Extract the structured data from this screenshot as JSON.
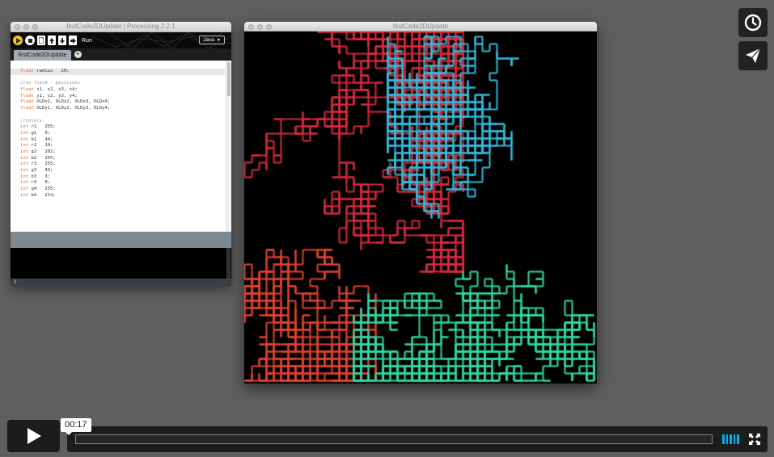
{
  "ide": {
    "window_title": "firstCode2DUpdate | Processing 2.2.1",
    "run_label": "Run",
    "mode": "Java",
    "tab_label": "firstCode2DUpdate",
    "line_number": "2",
    "code_lines": [
      [
        {
          "t": "float",
          "c": "kw"
        },
        {
          "t": " radius   20;"
        }
      ],
      [
        {
          "t": ""
        }
      ],
      [
        {
          "t": "//on field - positions",
          "c": "cm"
        }
      ],
      [
        {
          "t": "float",
          "c": "kw"
        },
        {
          "t": " x1, x2, x3, x4;"
        }
      ],
      [
        {
          "t": "float",
          "c": "kw"
        },
        {
          "t": " y1, y2, y3, y4;"
        }
      ],
      [
        {
          "t": "float",
          "c": "kw"
        },
        {
          "t": " OLDx1, OLDx2, OLDx3, OLDx4;"
        }
      ],
      [
        {
          "t": "float",
          "c": "kw"
        },
        {
          "t": " OLDy1, OLDy2, OLDy3, OLDy4;"
        }
      ],
      [
        {
          "t": ""
        }
      ],
      [
        {
          "t": "//colors",
          "c": "cm"
        }
      ],
      [
        {
          "t": "int",
          "c": "kw"
        },
        {
          "t": " r1   255;"
        }
      ],
      [
        {
          "t": "int",
          "c": "kw"
        },
        {
          "t": " g1   0;"
        }
      ],
      [
        {
          "t": "int",
          "c": "kw"
        },
        {
          "t": " b1   44;"
        }
      ],
      [
        {
          "t": "int",
          "c": "kw"
        },
        {
          "t": " r2   10;"
        }
      ],
      [
        {
          "t": "int",
          "c": "kw"
        },
        {
          "t": " g2   202;"
        }
      ],
      [
        {
          "t": "int",
          "c": "kw"
        },
        {
          "t": " b2   255;"
        }
      ],
      [
        {
          "t": "int",
          "c": "kw"
        },
        {
          "t": " r3   255;"
        }
      ],
      [
        {
          "t": "int",
          "c": "kw"
        },
        {
          "t": " g3   49;"
        }
      ],
      [
        {
          "t": "int",
          "c": "kw"
        },
        {
          "t": " b3   3;"
        }
      ],
      [
        {
          "t": "int",
          "c": "kw"
        },
        {
          "t": " r4   0;"
        }
      ],
      [
        {
          "t": "int",
          "c": "kw"
        },
        {
          "t": " g4   255;"
        }
      ],
      [
        {
          "t": "int",
          "c": "kw"
        },
        {
          "t": " b4   214;"
        }
      ]
    ]
  },
  "sketch": {
    "window_title": "firstCode2DUpdate",
    "walker_colors": [
      "#d8283d",
      "#36b8d8",
      "#e0412f",
      "#2fd9a4"
    ]
  },
  "player": {
    "time": "00:17",
    "played_fraction": 0.0,
    "volume_bars": 5,
    "accent": "#00adef"
  }
}
